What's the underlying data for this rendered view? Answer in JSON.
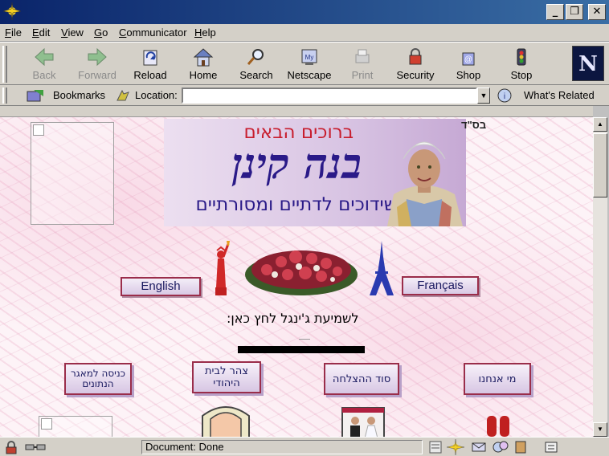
{
  "window": {
    "minimize_label": "_",
    "restore_label": "❐",
    "close_label": "✕"
  },
  "menu": [
    {
      "key": "F",
      "rest": "ile"
    },
    {
      "key": "E",
      "rest": "dit"
    },
    {
      "key": "V",
      "rest": "iew"
    },
    {
      "key": "G",
      "rest": "o"
    },
    {
      "key": "C",
      "rest": "ommunicator"
    },
    {
      "key": "H",
      "rest": "elp"
    }
  ],
  "toolbar": {
    "back": "Back",
    "forward": "Forward",
    "reload": "Reload",
    "home": "Home",
    "search": "Search",
    "netscape": "Netscape",
    "print": "Print",
    "security": "Security",
    "shop": "Shop",
    "stop": "Stop"
  },
  "locationbar": {
    "bookmarks": "Bookmarks",
    "location": "Location:",
    "url": "",
    "whats_related": "What's Related"
  },
  "page": {
    "banner": {
      "greeting": "ברוכים הבאים",
      "name": "בנה קינן",
      "subtitle": "שידוכים לדתיים ומסורתיים",
      "bsd": "בס\"ד"
    },
    "english_button": "English",
    "french_button": "Français",
    "jingle_text": "לשמיעת ג'ינגל לחץ כאן:",
    "nav": {
      "database": "כניסה למאגר הנתונים",
      "jewish_home": "צהר לבית היהודי",
      "success_secret": "סוד ההצלחה",
      "about_us": "מי אנחנו"
    }
  },
  "status": {
    "text": "Document: Done"
  }
}
